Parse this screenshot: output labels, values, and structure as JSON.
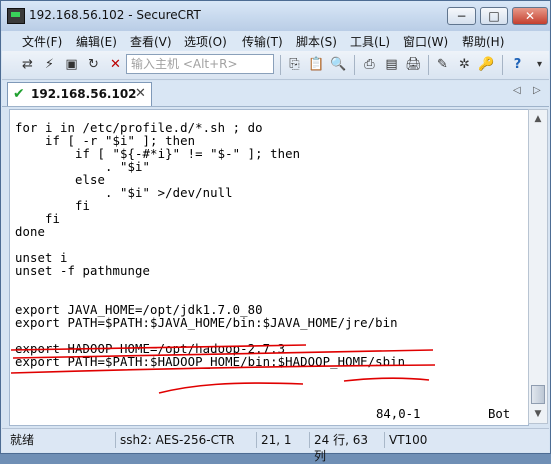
{
  "window": {
    "title": "192.168.56.102 - SecureCRT",
    "buttons": {
      "minimize": "−",
      "maximize": "□",
      "close": "✕"
    }
  },
  "menu": [
    "文件(F)",
    "编辑(E)",
    "查看(V)",
    "选项(O)",
    "传输(T)",
    "脚本(S)",
    "工具(L)",
    "窗口(W)",
    "帮助(H)"
  ],
  "toolbar": {
    "quick_connect_placeholder": "输入主机 <Alt+R>"
  },
  "tab": {
    "label": "192.168.56.102"
  },
  "terminal": {
    "lines": [
      "for i in /etc/profile.d/*.sh ; do",
      "    if [ -r \"$i\" ]; then",
      "        if [ \"${-#*i}\" != \"$-\" ]; then",
      "            . \"$i\"",
      "        else",
      "            . \"$i\" >/dev/null",
      "        fi",
      "    fi",
      "done",
      "",
      "unset i",
      "unset -f pathmunge",
      "",
      "",
      "export JAVA_HOME=/opt/jdk1.7.0_80",
      "export PATH=$PATH:$JAVA_HOME/bin:$JAVA_HOME/jre/bin",
      "",
      "export HADOOP_HOME=/opt/hadoop-2.7.3",
      "export PATH=$PATH:$HADOOP_HOME/bin:$HADOOP_HOME/sbin"
    ],
    "cursor_position": "84,0-1",
    "scroll_position": "Bot"
  },
  "status_bar": {
    "ready": "就绪",
    "encryption": "ssh2: AES-256-CTR",
    "cursor": "21,  1",
    "rows_cols": "24 行, 63 列",
    "terminal_type": "VT100"
  },
  "annotation_color": "#e00000"
}
